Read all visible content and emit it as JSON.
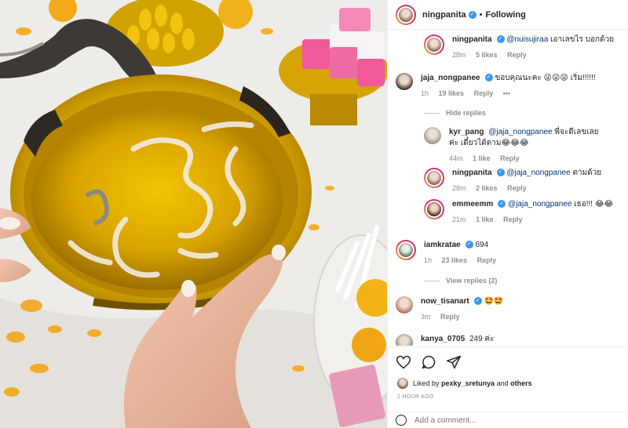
{
  "post": {
    "author": "ningpanita",
    "follow_state": "Following",
    "separator": "•"
  },
  "comments": [
    {
      "user": "ningpanita",
      "mention": "@nuisujiraa",
      "text": "เอาเลขไร บอกด้วย",
      "time": "28m",
      "likes": "5 likes",
      "reply": "Reply"
    },
    {
      "user": "jaja_nongpanee",
      "mention": "",
      "text": "ขอบคุณนะคะ 😜😜😜 เริ่ม!!!!!!",
      "time": "1h",
      "likes": "19 likes",
      "reply": "Reply",
      "more": "•••"
    },
    {
      "user": "kyr_pang",
      "mention": "@jaja_nongpanee",
      "text": "พี่จะดีเลขเลยค่ะ เดี๋ยวได้ตาม😂😂😂",
      "time": "44m",
      "likes": "1 like",
      "reply": "Reply"
    },
    {
      "user": "ningpanita",
      "mention": "@jaja_nongpanee",
      "text": "ตามด้วย",
      "time": "28m",
      "likes": "2 likes",
      "reply": "Reply"
    },
    {
      "user": "emmeemm",
      "mention": "@jaja_nongpanee",
      "text": "เธอ!!! 😂😂",
      "time": "21m",
      "likes": "1 like",
      "reply": "Reply"
    },
    {
      "user": "iamkratae",
      "mention": "",
      "text": "694",
      "time": "1h",
      "likes": "23 likes",
      "reply": "Reply"
    },
    {
      "user": "now_tisanart",
      "mention": "",
      "text": "🤩🤩",
      "time": "3m",
      "likes": "",
      "reply": "Reply"
    },
    {
      "user": "kanya_0705",
      "mention": "",
      "text": "249 ค่ะ",
      "time": "",
      "likes": "",
      "reply": ""
    }
  ],
  "hide_replies": "Hide replies",
  "view_replies": "View replies (2)",
  "liked_by": {
    "prefix": "Liked by",
    "user": "pexky_sretunya",
    "and": "and",
    "others": "others"
  },
  "time_ago": "1 HOUR AGO",
  "add_comment_placeholder": "Add a comment...",
  "icons": [
    "heart-icon",
    "comment-icon",
    "share-icon",
    "verified-icon"
  ],
  "colors": {
    "verified": "#3897f0",
    "muted": "#8e8e8e",
    "text": "#262626",
    "mention": "#00376b"
  }
}
